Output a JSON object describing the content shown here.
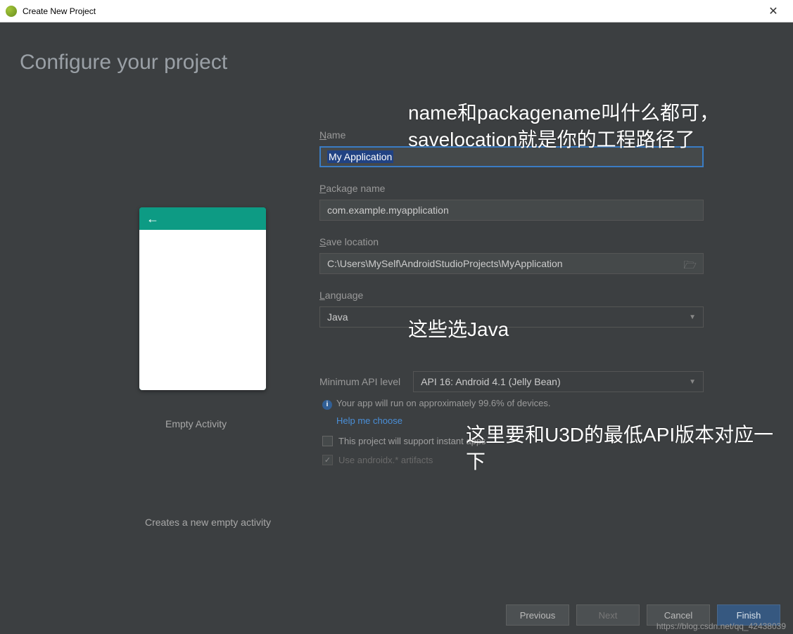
{
  "window": {
    "title": "Create New Project"
  },
  "heading": "Configure your project",
  "preview": {
    "template_name": "Empty Activity",
    "description": "Creates a new empty activity"
  },
  "form": {
    "name": {
      "label": "Name",
      "value": "My Application"
    },
    "package": {
      "label": "Package name",
      "value": "com.example.myapplication"
    },
    "save": {
      "label": "Save location",
      "value": "C:\\Users\\MySelf\\AndroidStudioProjects\\MyApplication"
    },
    "language": {
      "label": "Language",
      "value": "Java"
    },
    "api": {
      "label": "Minimum API level",
      "value": "API 16: Android 4.1 (Jelly Bean)",
      "info": "Your app will run on approximately 99.6% of devices.",
      "help_link": "Help me choose"
    },
    "instant_apps": {
      "label": "This project will support instant apps",
      "checked": false
    },
    "androidx": {
      "label": "Use androidx.* artifacts",
      "checked": true,
      "disabled": true
    }
  },
  "buttons": {
    "previous": "Previous",
    "next": "Next",
    "cancel": "Cancel",
    "finish": "Finish"
  },
  "annotations": {
    "a1": "name和packagename叫什么都可，savelocation就是你的工程路径了",
    "a2": "这些选Java",
    "a3": "这里要和U3D的最低API版本对应一下"
  },
  "watermark": "https://blog.csdn.net/qq_42438039"
}
